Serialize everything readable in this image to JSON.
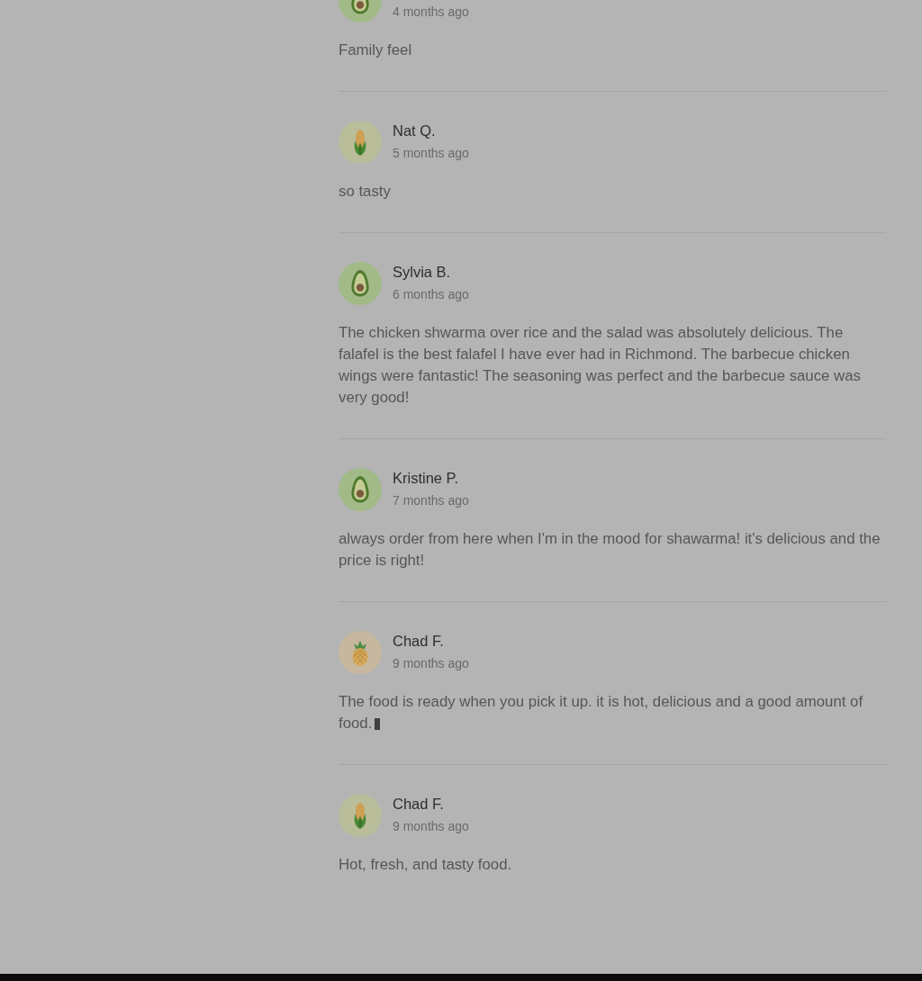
{
  "reviews": [
    {
      "kind": "avocado",
      "date": "4 months ago",
      "text": "Family feel",
      "trailing_box": false
    },
    {
      "kind": "corn",
      "name": "Nat Q.",
      "date": "5 months ago",
      "text": "so tasty",
      "trailing_box": false
    },
    {
      "kind": "avocado",
      "name": "Sylvia B.",
      "date": "6 months ago",
      "text": "The chicken shwarma over rice and the salad was absolutely delicious. The falafel is the best falafel I have ever had in Richmond. The barbecue chicken wings were fantastic! The seasoning was perfect and the barbecue sauce was very good!",
      "trailing_box": false
    },
    {
      "kind": "avocado",
      "name": "Kristine P.",
      "date": "7 months ago",
      "text": "always order from here when I'm in the mood for shawarma! it's delicious and the price is right!",
      "trailing_box": false
    },
    {
      "kind": "pineapple",
      "name": "Chad F.",
      "date": "9 months ago",
      "text": "The food is ready when you pick it up. it is hot, delicious and a good amount of food.",
      "trailing_box": true
    },
    {
      "kind": "corn",
      "name": "Chad F.",
      "date": "9 months ago",
      "text": "Hot, fresh, and tasty food.",
      "trailing_box": false
    }
  ]
}
